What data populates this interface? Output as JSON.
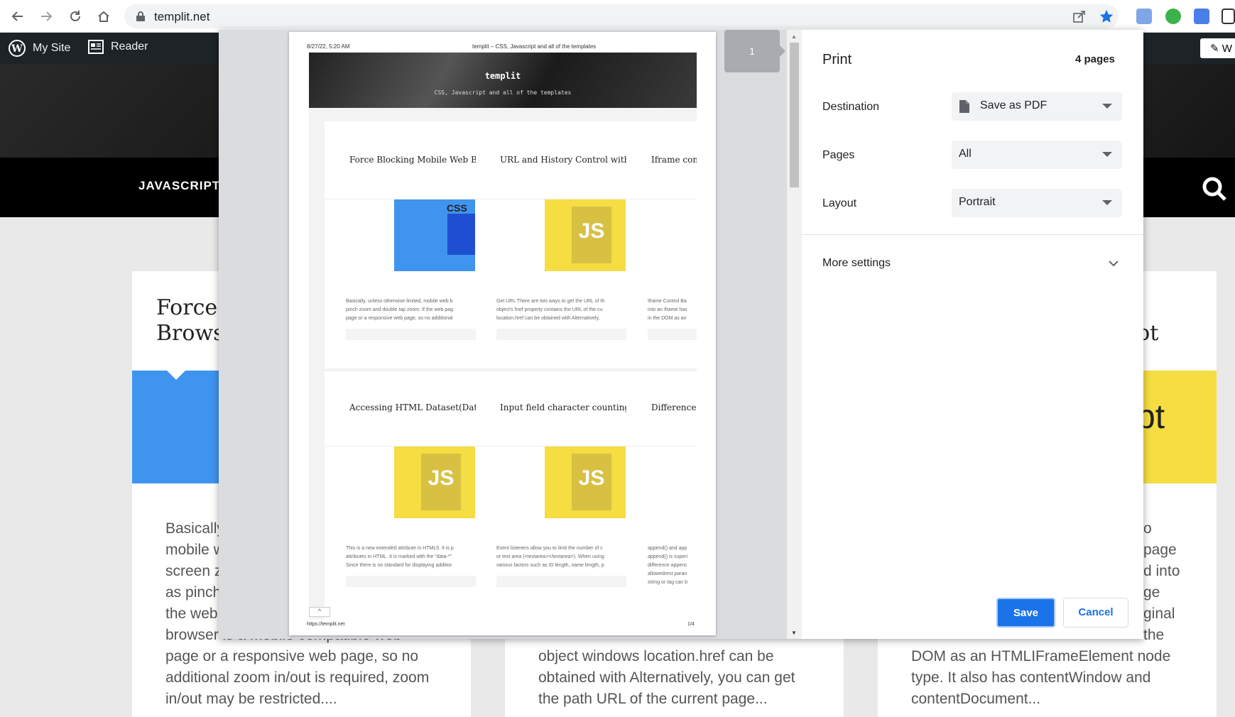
{
  "browser": {
    "url": "templit.net",
    "icons": [
      "back-icon",
      "forward-icon",
      "reload-icon",
      "home-icon",
      "lock-icon",
      "share-icon",
      "star-icon"
    ]
  },
  "adminbar": {
    "my_site": "My Site",
    "reader": "Reader",
    "right_partial": "W"
  },
  "site": {
    "nav_item": "JAVASCRIPT",
    "cards": [
      {
        "title_1": "Force I",
        "title_2": "Brows",
        "text": [
          "Basically",
          "mobile w",
          "screen z",
          "as pinch",
          "the web",
          "browser is a mobile compatible web",
          "page or a responsive web page, so no",
          "additional zoom in/out is required, zoom",
          "in/out may be restricted...."
        ]
      },
      {
        "text_1": "object windows location.href can be",
        "text_2": "obtained with Alternatively, you can get",
        "text_3": "the path URL of the current page..."
      },
      {
        "title_right": "pt",
        "image_right": "pt",
        "text": [
          "o",
          "page",
          "d into",
          "ge",
          "ginal",
          "the",
          "DOM as an HTMLIFrameElement node",
          "type. It also has contentWindow and",
          "contentDocument..."
        ]
      }
    ]
  },
  "preview": {
    "header_left": "8/27/22, 5:20 AM",
    "header_center": "templit – CSS, Javascript and all of the templates",
    "banner_title": "templit",
    "banner_sub": "CSS, Javascript and all of the templates",
    "footer_left": "https://templit.net",
    "footer_right": "1/4",
    "thumb_page": "1",
    "row1": [
      {
        "title": "Force Blocking Mobile Web Bro",
        "img": "CSS",
        "excerpt": [
          "Basically, unless otherwise limited, mobile web b",
          "pinch zoom and double tap zoom. If the web pag",
          "page or a responsive web page, so no additional"
        ]
      },
      {
        "title": "URL and History Control with J",
        "img": "JS",
        "excerpt": [
          "Get URL There are two ways to get the URL of th",
          "object's href property contains the URL of the cu",
          "location.href can be obtained with Alternatively,"
        ]
      },
      {
        "title": "Iframe con",
        "img": "",
        "excerpt": [
          "Iframe Control Ba",
          "into an iframe has",
          "in the DOM as an"
        ]
      }
    ],
    "row2": [
      {
        "title": "Accessing HTML Dataset(Datas",
        "img": "JS",
        "excerpt": [
          "This is a new extended attribute in HTML5. It is p",
          "attributes in HTML. It is marked with the \"data-*\"",
          "Since there is no standard for displaying additior"
        ]
      },
      {
        "title": "Input field character counting",
        "img": "JS",
        "excerpt": [
          "Event listeners allow you to limit the number of c",
          "or text area (<textarea></textarea>). When using",
          "various factors such as ID length, name length, p"
        ]
      },
      {
        "title": "Difference",
        "img": "",
        "excerpt": [
          "append() and app",
          "append() is superi",
          "difference appenc",
          "allowedrest paran",
          "string or tag can b"
        ]
      }
    ]
  },
  "print": {
    "title": "Print",
    "pages_count": "4 pages",
    "destination_label": "Destination",
    "destination_value": "Save as PDF",
    "pages_label": "Pages",
    "pages_value": "All",
    "layout_label": "Layout",
    "layout_value": "Portrait",
    "more_settings": "More settings",
    "save": "Save",
    "cancel": "Cancel",
    "accent": "#1a73e8"
  }
}
